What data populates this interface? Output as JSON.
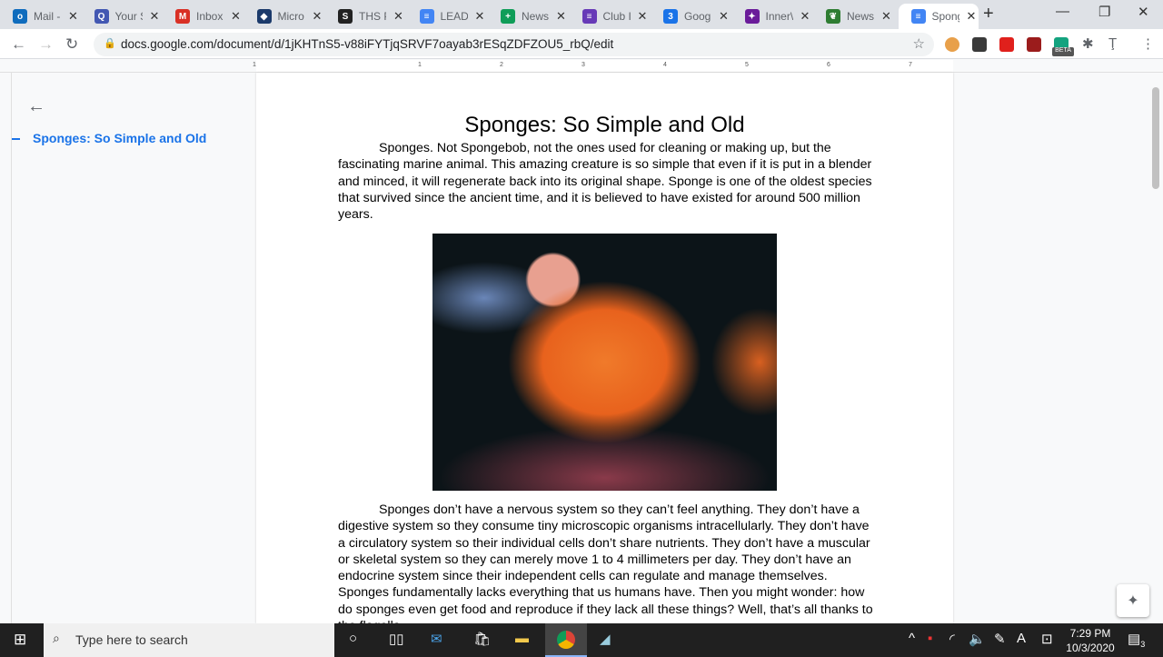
{
  "tabs": [
    {
      "label": "Mail -",
      "icon": "outlook-icon",
      "color": "#0f6cbd",
      "glyph": "o"
    },
    {
      "label": "Your S",
      "icon": "quizlet-icon",
      "color": "#4257b2",
      "glyph": "Q"
    },
    {
      "label": "Inbox",
      "icon": "gmail-icon",
      "color": "#d93025",
      "glyph": "M"
    },
    {
      "label": "Micro",
      "icon": "microsoft-stack-icon",
      "color": "#1b3a6b",
      "glyph": "◆"
    },
    {
      "label": "THS P",
      "icon": "s-circle-icon",
      "color": "#222",
      "glyph": "S"
    },
    {
      "label": "LEAD",
      "icon": "google-docs-icon",
      "color": "#4285f4",
      "glyph": "≡"
    },
    {
      "label": "News",
      "icon": "google-sheets-icon",
      "color": "#0f9d58",
      "glyph": "+"
    },
    {
      "label": "Club I",
      "icon": "google-forms-icon",
      "color": "#673ab7",
      "glyph": "≡"
    },
    {
      "label": "Goog",
      "icon": "google-calendar-icon",
      "color": "#1a73e8",
      "glyph": "3"
    },
    {
      "label": "Inner\\",
      "icon": "innervate-icon",
      "color": "#6a1b9a",
      "glyph": "✦"
    },
    {
      "label": "News",
      "icon": "leaf-icon",
      "color": "#2e7d32",
      "glyph": "❦"
    },
    {
      "label": "Spong",
      "icon": "google-docs-icon",
      "color": "#4285f4",
      "glyph": "≡"
    }
  ],
  "url": "docs.google.com/document/d/1jKHTnS5-v88iFYTjqSRVF7oayab3rESqZDFZOU5_rbQ/edit",
  "extensions": [
    {
      "name": "honey-extension-icon",
      "color": "#e8a04a"
    },
    {
      "name": "clock-extension-icon",
      "color": "#3a3a3a"
    },
    {
      "name": "adblock-extension-icon",
      "color": "#e0201c"
    },
    {
      "name": "acrobat-extension-icon",
      "color": "#9b1c1c"
    },
    {
      "name": "beta-extension-icon",
      "color": "#14a37f"
    }
  ],
  "beta_label": "BETA",
  "ruler_numbers": [
    "1",
    "1",
    "2",
    "3",
    "4",
    "5",
    "6",
    "7"
  ],
  "outline": {
    "item": "Sponges: So Simple and Old"
  },
  "doc": {
    "title": "Sponges: So Simple and Old",
    "p1": "Sponges. Not Spongebob, not the ones used for cleaning or making up, but the fascinating marine animal. This amazing creature is so simple that even if it is put in a blender and minced, it will regenerate back into its original shape. Sponge is one of the oldest species that survived since the ancient time, and it is believed to have existed for around 500 million years.",
    "p2": "Sponges don’t have a nervous system so they can’t feel anything. They don’t have a digestive system so they consume tiny microscopic organisms intracellularly. They don’t have a circulatory system so their individual cells don’t share nutrients. They don’t have a muscular or skeletal system so they can merely move 1 to 4 millimeters per day. They don’t have an endocrine system since their independent cells can regulate and manage themselves. Sponges fundamentally lacks everything that us humans have. Then you might wonder: how do sponges even get food and reproduce if they lack all these things? Well, that’s all thanks to the flagella."
  },
  "taskbar": {
    "search_placeholder": "Type here to search",
    "time": "7:29 PM",
    "date": "10/3/2020",
    "notifications": "3",
    "lang": "A"
  }
}
